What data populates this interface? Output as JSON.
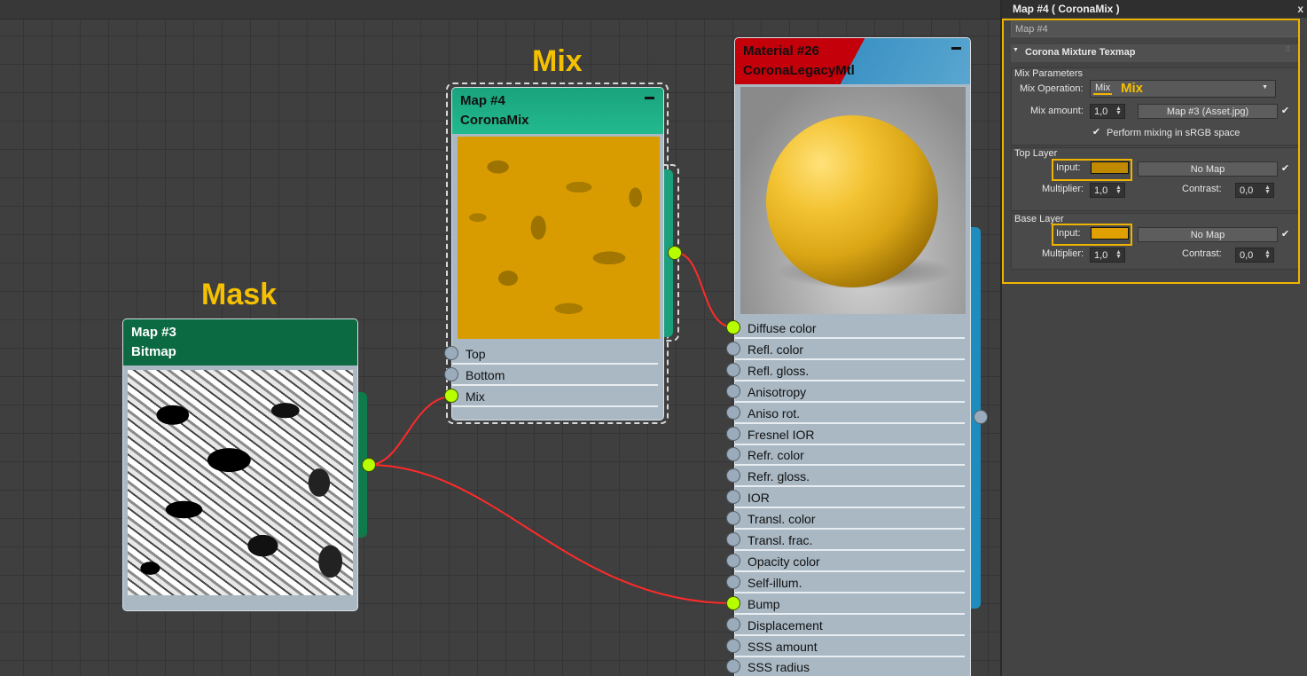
{
  "canvas": {
    "annotations": {
      "mix": "Mix",
      "mask": "Mask"
    }
  },
  "nodes": {
    "mix_node": {
      "name": "Map #4",
      "type": "CoronaMix",
      "header_color": "#1aa07c",
      "slots": [
        "Top",
        "Bottom",
        "Mix"
      ],
      "connected_slots": [
        "Mix"
      ]
    },
    "mask_node": {
      "name": "Map #3",
      "type": "Bitmap",
      "header_color": "#0b6a42"
    },
    "material_node": {
      "name": "Material #26",
      "type": "CoronaLegacyMtl",
      "header_colors": [
        "#c4000b",
        "#2a8fc0"
      ],
      "slots": [
        "Diffuse color",
        "Refl. color",
        "Refl. gloss.",
        "Anisotropy",
        "Aniso rot.",
        "Fresnel IOR",
        "Refr. color",
        "Refr. gloss.",
        "IOR",
        "Transl. color",
        "Transl. frac.",
        "Opacity color",
        "Self-illum.",
        "Bump",
        "Displacement",
        "SSS amount",
        "SSS radius"
      ],
      "connected_slots": [
        "Diffuse color",
        "Bump"
      ]
    }
  },
  "panel": {
    "title": "Map #4  ( CoronaMix )",
    "close_glyph": "x",
    "name_field": "Map #4",
    "rollout_title": "Corona Mixture Texmap",
    "rollout_arrow": "▼",
    "mix_params": {
      "group_label": "Mix Parameters",
      "operation_label": "Mix Operation:",
      "operation_value": "Mix",
      "operation_annotation": "Mix",
      "amount_label": "Mix amount:",
      "amount_value": "1,0",
      "amount_map": "Map #3 (Asset.jpg)",
      "srgb_label": "Perform mixing in sRGB space",
      "srgb_checked": true
    },
    "top_layer": {
      "group_label": "Top Layer",
      "input_label": "Input:",
      "input_color": "#c08a00",
      "map_label": "No Map",
      "multiplier_label": "Multiplier:",
      "multiplier_value": "1,0",
      "contrast_label": "Contrast:",
      "contrast_value": "0,0"
    },
    "base_layer": {
      "group_label": "Base Layer",
      "input_label": "Input:",
      "input_color": "#e0a000",
      "map_label": "No Map",
      "multiplier_label": "Multiplier:",
      "multiplier_value": "1,0",
      "contrast_label": "Contrast:",
      "contrast_value": "0,0"
    },
    "highlight_color": "#f0b400",
    "check_glyph": "✔",
    "spin_glyph": "▲▼",
    "dropdown_glyph": "▼"
  }
}
